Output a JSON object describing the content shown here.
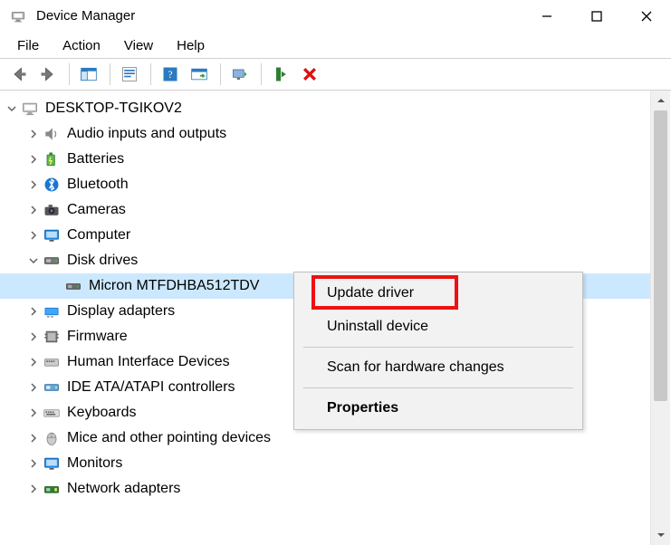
{
  "window": {
    "title": "Device Manager"
  },
  "menubar": [
    "File",
    "Action",
    "View",
    "Help"
  ],
  "tree": {
    "root": {
      "label": "DESKTOP-TGIKOV2",
      "expanded": true
    },
    "children": [
      {
        "label": "Audio inputs and outputs",
        "icon": "speaker",
        "expanded": false
      },
      {
        "label": "Batteries",
        "icon": "battery",
        "expanded": false
      },
      {
        "label": "Bluetooth",
        "icon": "bluetooth",
        "expanded": false
      },
      {
        "label": "Cameras",
        "icon": "camera",
        "expanded": false
      },
      {
        "label": "Computer",
        "icon": "computer",
        "expanded": false
      },
      {
        "label": "Disk drives",
        "icon": "diskdrive",
        "expanded": true,
        "children": [
          {
            "label": "Micron MTFDHBA512TDV",
            "icon": "diskdrive-small",
            "selected": true
          }
        ]
      },
      {
        "label": "Display adapters",
        "icon": "display",
        "expanded": false
      },
      {
        "label": "Firmware",
        "icon": "firmware",
        "expanded": false
      },
      {
        "label": "Human Interface Devices",
        "icon": "hid",
        "expanded": false
      },
      {
        "label": "IDE ATA/ATAPI controllers",
        "icon": "ide",
        "expanded": false
      },
      {
        "label": "Keyboards",
        "icon": "keyboard",
        "expanded": false
      },
      {
        "label": "Mice and other pointing devices",
        "icon": "mouse",
        "expanded": false
      },
      {
        "label": "Monitors",
        "icon": "monitor",
        "expanded": false
      },
      {
        "label": "Network adapters",
        "icon": "network",
        "expanded": false
      }
    ]
  },
  "context_menu": {
    "items": [
      "Update driver",
      "Uninstall device"
    ],
    "items2": [
      "Scan for hardware changes"
    ],
    "items3": [
      "Properties"
    ]
  }
}
